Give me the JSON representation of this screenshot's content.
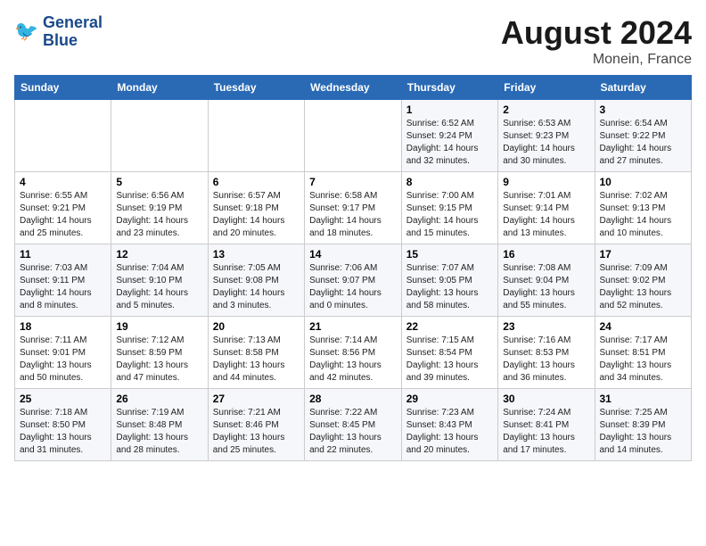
{
  "logo": {
    "line1": "General",
    "line2": "Blue"
  },
  "title": "August 2024",
  "location": "Monein, France",
  "days_header": [
    "Sunday",
    "Monday",
    "Tuesday",
    "Wednesday",
    "Thursday",
    "Friday",
    "Saturday"
  ],
  "weeks": [
    [
      {
        "day": "",
        "info": ""
      },
      {
        "day": "",
        "info": ""
      },
      {
        "day": "",
        "info": ""
      },
      {
        "day": "",
        "info": ""
      },
      {
        "day": "1",
        "info": "Sunrise: 6:52 AM\nSunset: 9:24 PM\nDaylight: 14 hours\nand 32 minutes."
      },
      {
        "day": "2",
        "info": "Sunrise: 6:53 AM\nSunset: 9:23 PM\nDaylight: 14 hours\nand 30 minutes."
      },
      {
        "day": "3",
        "info": "Sunrise: 6:54 AM\nSunset: 9:22 PM\nDaylight: 14 hours\nand 27 minutes."
      }
    ],
    [
      {
        "day": "4",
        "info": "Sunrise: 6:55 AM\nSunset: 9:21 PM\nDaylight: 14 hours\nand 25 minutes."
      },
      {
        "day": "5",
        "info": "Sunrise: 6:56 AM\nSunset: 9:19 PM\nDaylight: 14 hours\nand 23 minutes."
      },
      {
        "day": "6",
        "info": "Sunrise: 6:57 AM\nSunset: 9:18 PM\nDaylight: 14 hours\nand 20 minutes."
      },
      {
        "day": "7",
        "info": "Sunrise: 6:58 AM\nSunset: 9:17 PM\nDaylight: 14 hours\nand 18 minutes."
      },
      {
        "day": "8",
        "info": "Sunrise: 7:00 AM\nSunset: 9:15 PM\nDaylight: 14 hours\nand 15 minutes."
      },
      {
        "day": "9",
        "info": "Sunrise: 7:01 AM\nSunset: 9:14 PM\nDaylight: 14 hours\nand 13 minutes."
      },
      {
        "day": "10",
        "info": "Sunrise: 7:02 AM\nSunset: 9:13 PM\nDaylight: 14 hours\nand 10 minutes."
      }
    ],
    [
      {
        "day": "11",
        "info": "Sunrise: 7:03 AM\nSunset: 9:11 PM\nDaylight: 14 hours\nand 8 minutes."
      },
      {
        "day": "12",
        "info": "Sunrise: 7:04 AM\nSunset: 9:10 PM\nDaylight: 14 hours\nand 5 minutes."
      },
      {
        "day": "13",
        "info": "Sunrise: 7:05 AM\nSunset: 9:08 PM\nDaylight: 14 hours\nand 3 minutes."
      },
      {
        "day": "14",
        "info": "Sunrise: 7:06 AM\nSunset: 9:07 PM\nDaylight: 14 hours\nand 0 minutes."
      },
      {
        "day": "15",
        "info": "Sunrise: 7:07 AM\nSunset: 9:05 PM\nDaylight: 13 hours\nand 58 minutes."
      },
      {
        "day": "16",
        "info": "Sunrise: 7:08 AM\nSunset: 9:04 PM\nDaylight: 13 hours\nand 55 minutes."
      },
      {
        "day": "17",
        "info": "Sunrise: 7:09 AM\nSunset: 9:02 PM\nDaylight: 13 hours\nand 52 minutes."
      }
    ],
    [
      {
        "day": "18",
        "info": "Sunrise: 7:11 AM\nSunset: 9:01 PM\nDaylight: 13 hours\nand 50 minutes."
      },
      {
        "day": "19",
        "info": "Sunrise: 7:12 AM\nSunset: 8:59 PM\nDaylight: 13 hours\nand 47 minutes."
      },
      {
        "day": "20",
        "info": "Sunrise: 7:13 AM\nSunset: 8:58 PM\nDaylight: 13 hours\nand 44 minutes."
      },
      {
        "day": "21",
        "info": "Sunrise: 7:14 AM\nSunset: 8:56 PM\nDaylight: 13 hours\nand 42 minutes."
      },
      {
        "day": "22",
        "info": "Sunrise: 7:15 AM\nSunset: 8:54 PM\nDaylight: 13 hours\nand 39 minutes."
      },
      {
        "day": "23",
        "info": "Sunrise: 7:16 AM\nSunset: 8:53 PM\nDaylight: 13 hours\nand 36 minutes."
      },
      {
        "day": "24",
        "info": "Sunrise: 7:17 AM\nSunset: 8:51 PM\nDaylight: 13 hours\nand 34 minutes."
      }
    ],
    [
      {
        "day": "25",
        "info": "Sunrise: 7:18 AM\nSunset: 8:50 PM\nDaylight: 13 hours\nand 31 minutes."
      },
      {
        "day": "26",
        "info": "Sunrise: 7:19 AM\nSunset: 8:48 PM\nDaylight: 13 hours\nand 28 minutes."
      },
      {
        "day": "27",
        "info": "Sunrise: 7:21 AM\nSunset: 8:46 PM\nDaylight: 13 hours\nand 25 minutes."
      },
      {
        "day": "28",
        "info": "Sunrise: 7:22 AM\nSunset: 8:45 PM\nDaylight: 13 hours\nand 22 minutes."
      },
      {
        "day": "29",
        "info": "Sunrise: 7:23 AM\nSunset: 8:43 PM\nDaylight: 13 hours\nand 20 minutes."
      },
      {
        "day": "30",
        "info": "Sunrise: 7:24 AM\nSunset: 8:41 PM\nDaylight: 13 hours\nand 17 minutes."
      },
      {
        "day": "31",
        "info": "Sunrise: 7:25 AM\nSunset: 8:39 PM\nDaylight: 13 hours\nand 14 minutes."
      }
    ]
  ]
}
